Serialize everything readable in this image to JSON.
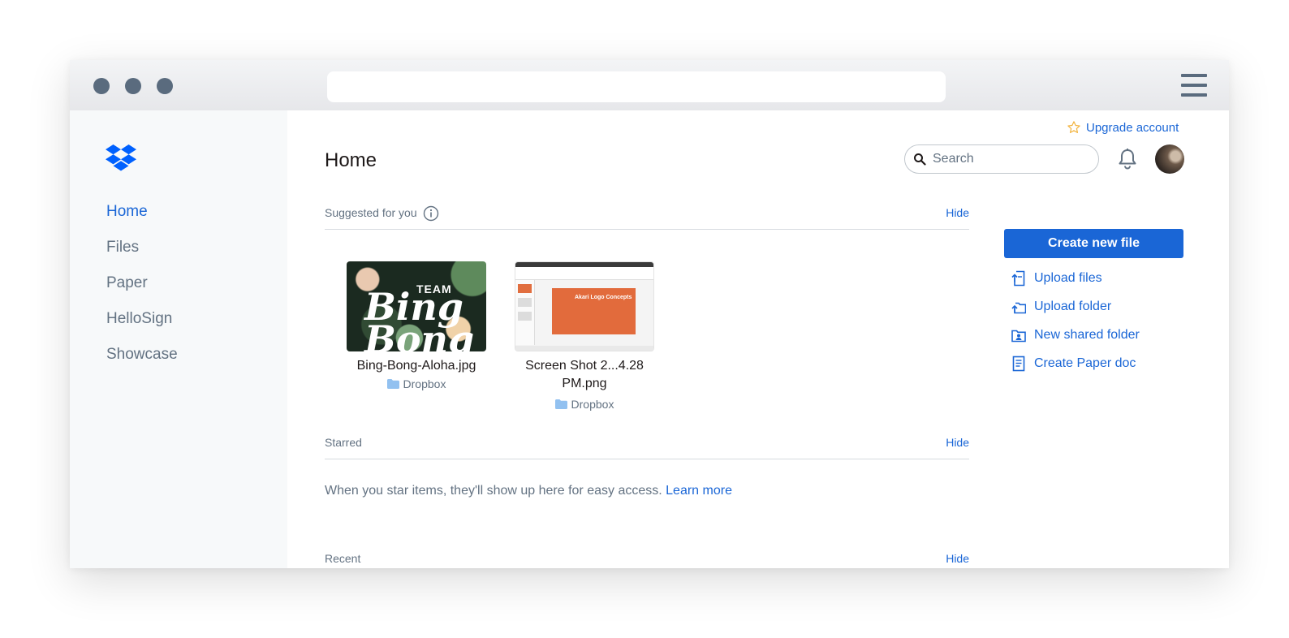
{
  "sidebar": {
    "items": [
      {
        "label": "Home",
        "active": true
      },
      {
        "label": "Files",
        "active": false
      },
      {
        "label": "Paper",
        "active": false
      },
      {
        "label": "HelloSign",
        "active": false
      },
      {
        "label": "Showcase",
        "active": false
      }
    ]
  },
  "header": {
    "title": "Home",
    "upgrade_label": "Upgrade account",
    "search_placeholder": "Search"
  },
  "suggested": {
    "label": "Suggested for you",
    "hide_label": "Hide",
    "files": [
      {
        "name": "Bing-Bong-Aloha.jpg",
        "location": "Dropbox",
        "thumb_text_1": "TEAM",
        "thumb_text_2": "Bing Bong"
      },
      {
        "name_line1": "Screen Shot 2...4.28",
        "name_line2": "PM.png",
        "location": "Dropbox",
        "thumb_text": "Akari Logo Concepts"
      }
    ]
  },
  "starred": {
    "label": "Starred",
    "hide_label": "Hide",
    "empty_text": "When you star items, they'll show up here for easy access.",
    "learn_more": "Learn more"
  },
  "recent": {
    "label": "Recent",
    "hide_label": "Hide"
  },
  "actions": {
    "create_label": "Create new file",
    "items": [
      {
        "label": "Upload files",
        "icon": "upload-file-icon"
      },
      {
        "label": "Upload folder",
        "icon": "upload-folder-icon"
      },
      {
        "label": "New shared folder",
        "icon": "shared-folder-icon"
      },
      {
        "label": "Create Paper doc",
        "icon": "paper-doc-icon"
      }
    ]
  },
  "colors": {
    "accent": "#1a66d6",
    "muted_text": "#637282",
    "sidebar_bg": "#f7f9fa",
    "window_control": "#5a6b7e",
    "star": "#f2b33d"
  }
}
